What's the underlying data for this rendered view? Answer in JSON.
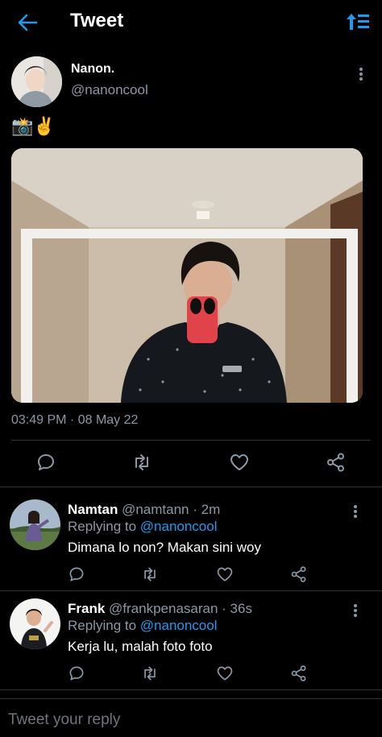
{
  "header": {
    "title": "Tweet"
  },
  "tweet": {
    "name": "Nanon.",
    "handle": "@nanoncool",
    "text": "📸✌️",
    "timestamp": "03:49 PM · 08 May 22"
  },
  "replies": [
    {
      "name": "Namtan",
      "meta": "@namtann · 2m",
      "replying_prefix": "Replying to ",
      "replying_to": "@nanoncool",
      "text": "Dimana lo non? Makan sini woy"
    },
    {
      "name": "Frank",
      "meta": "@frankpenasaran · 36s",
      "replying_prefix": "Replying to ",
      "replying_to": "@nanoncool",
      "text": "Kerja lu, malah foto foto"
    }
  ],
  "compose": {
    "placeholder": "Tweet your reply"
  },
  "icons": {
    "back": "arrow-left-icon",
    "sort": "sort-arrows-icon",
    "more": "more-vertical-icon",
    "reply": "reply-icon",
    "retweet": "retweet-icon",
    "like": "heart-icon",
    "share": "share-icon"
  },
  "colors": {
    "background": "#000000",
    "accent": "#1d9bf0",
    "muted": "#8b98a5",
    "divider": "#2f3336"
  }
}
